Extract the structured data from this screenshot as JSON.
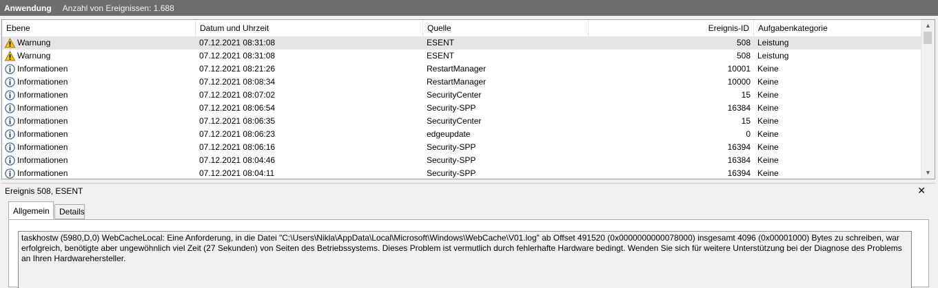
{
  "header": {
    "title": "Anwendung",
    "count_text": "Anzahl von Ereignissen: 1.688"
  },
  "columns": {
    "level": "Ebene",
    "datetime": "Datum und Uhrzeit",
    "source": "Quelle",
    "event_id": "Ereignis-ID",
    "category": "Aufgabenkategorie"
  },
  "rows": [
    {
      "icon": "warning-icon",
      "level": "Warnung",
      "datetime": "07.12.2021 08:31:08",
      "source": "ESENT",
      "event_id": "508",
      "category": "Leistung",
      "selected": true
    },
    {
      "icon": "warning-icon",
      "level": "Warnung",
      "datetime": "07.12.2021 08:31:08",
      "source": "ESENT",
      "event_id": "508",
      "category": "Leistung"
    },
    {
      "icon": "info-icon",
      "level": "Informationen",
      "datetime": "07.12.2021 08:21:26",
      "source": "RestartManager",
      "event_id": "10001",
      "category": "Keine"
    },
    {
      "icon": "info-icon",
      "level": "Informationen",
      "datetime": "07.12.2021 08:08:34",
      "source": "RestartManager",
      "event_id": "10000",
      "category": "Keine"
    },
    {
      "icon": "info-icon",
      "level": "Informationen",
      "datetime": "07.12.2021 08:07:02",
      "source": "SecurityCenter",
      "event_id": "15",
      "category": "Keine"
    },
    {
      "icon": "info-icon",
      "level": "Informationen",
      "datetime": "07.12.2021 08:06:54",
      "source": "Security-SPP",
      "event_id": "16384",
      "category": "Keine"
    },
    {
      "icon": "info-icon",
      "level": "Informationen",
      "datetime": "07.12.2021 08:06:35",
      "source": "SecurityCenter",
      "event_id": "15",
      "category": "Keine"
    },
    {
      "icon": "info-icon",
      "level": "Informationen",
      "datetime": "07.12.2021 08:06:23",
      "source": "edgeupdate",
      "event_id": "0",
      "category": "Keine"
    },
    {
      "icon": "info-icon",
      "level": "Informationen",
      "datetime": "07.12.2021 08:06:16",
      "source": "Security-SPP",
      "event_id": "16394",
      "category": "Keine"
    },
    {
      "icon": "info-icon",
      "level": "Informationen",
      "datetime": "07.12.2021 08:04:46",
      "source": "Security-SPP",
      "event_id": "16384",
      "category": "Keine"
    },
    {
      "icon": "info-icon",
      "level": "Informationen",
      "datetime": "07.12.2021 08:04:11",
      "source": "Security-SPP",
      "event_id": "16394",
      "category": "Keine"
    }
  ],
  "detail": {
    "title": "Ereignis 508, ESENT",
    "close_glyph": "✕",
    "tabs": [
      "Allgemein",
      "Details"
    ],
    "active_tab": "Allgemein",
    "message": "taskhostw (5980,D,0) WebCacheLocal: Eine Anforderung, in die Datei \"C:\\Users\\Nikla\\AppData\\Local\\Microsoft\\Windows\\WebCache\\V01.log\" ab Offset 491520 (0x0000000000078000) insgesamt 4096 (0x00001000) Bytes zu schreiben, war erfolgreich, benötigte aber ungewöhnlich viel Zeit (27 Sekunden) von Seiten des Betriebssystems. Dieses Problem ist vermutlich durch fehlerhafte Hardware bedingt. Wenden Sie sich für weitere Unterstützung bei der Diagnose des Problems an Ihren Hardwarehersteller."
  },
  "colors": {
    "topbar_bg": "#6d6d6d",
    "warning": "#f5c400",
    "info_ring": "#2d5fa8",
    "selected_row": "#e5e5e5"
  }
}
